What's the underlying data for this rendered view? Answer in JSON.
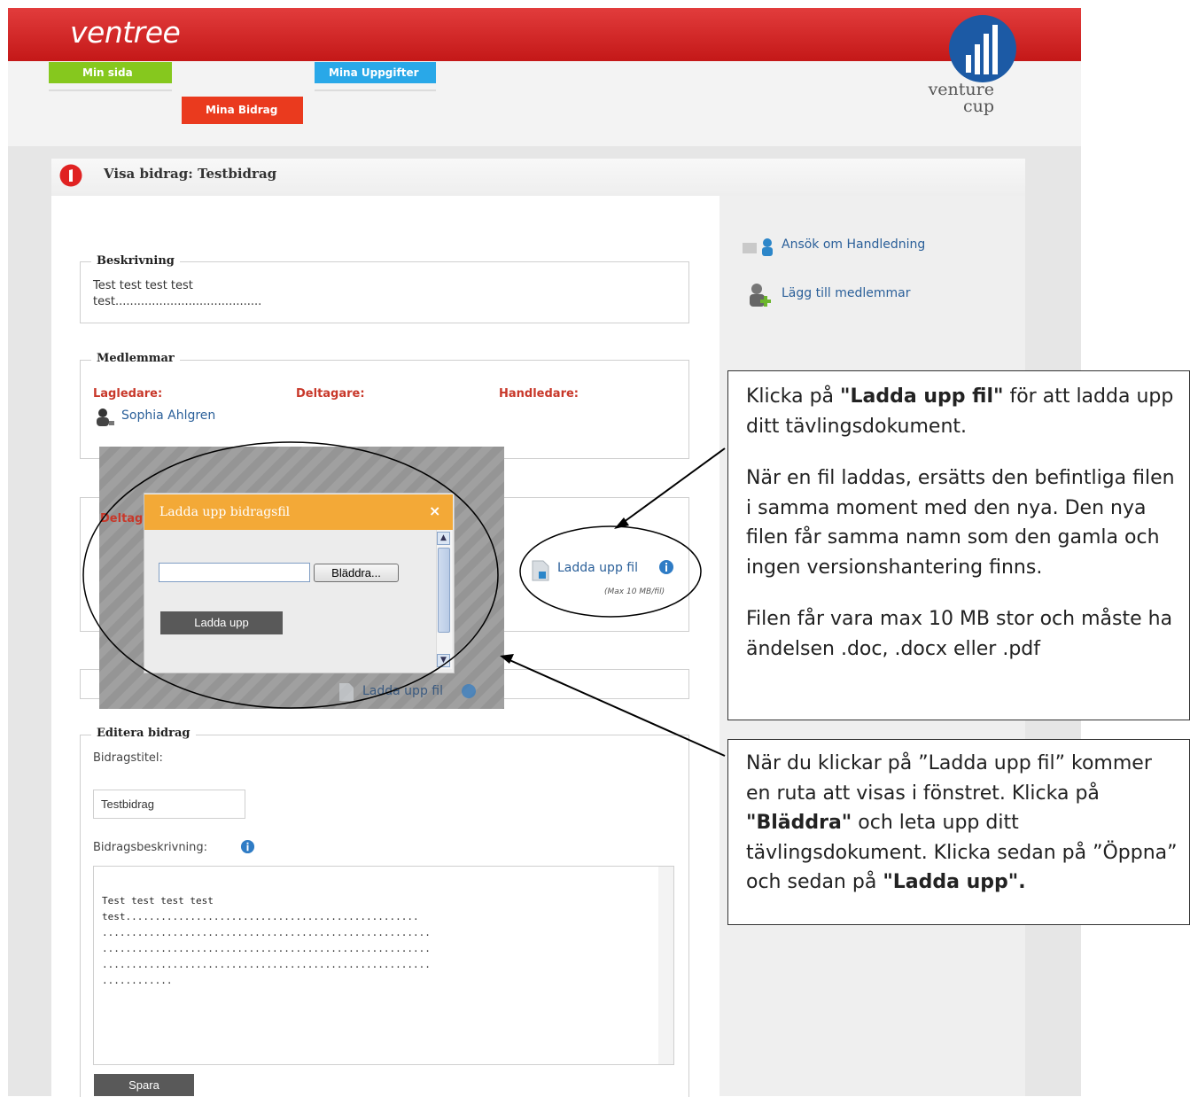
{
  "header": {
    "logo": "ventree",
    "brand": [
      "venture",
      "cup"
    ]
  },
  "nav": {
    "min_sida": "Min sida",
    "mina_uppgifter": "Mina Uppgifter",
    "mina_bidrag": "Mina Bidrag"
  },
  "page": {
    "step": "1",
    "title": "Visa bidrag: Testbidrag"
  },
  "sidebar": {
    "apply_mentor": "Ansök om Handledning",
    "add_members": "Lägg till medlemmar"
  },
  "beskrivning": {
    "legend": "Beskrivning",
    "line1": "Test test test test",
    "line2": "test........................................"
  },
  "medlemmar": {
    "legend": "Medlemmar",
    "lagledare": "Lagledare:",
    "deltagare": "Deltagare:",
    "handledare": "Handledare:",
    "member_name": "Sophia Ahlgren"
  },
  "upload": {
    "link": "Ladda upp fil",
    "max": "(Max 10 MB/fil)",
    "partial_label": "Deltag"
  },
  "dialog": {
    "title": "Ladda upp bidragsfil",
    "close": "×",
    "browse": "Bläddra...",
    "upload_button": "Ladda upp"
  },
  "editera": {
    "legend": "Editera bidrag",
    "title_label": "Bidragstitel:",
    "title_value": "Testbidrag",
    "desc_label": "Bidragsbeskrivning:",
    "desc_lines": [
      "Test test test test",
      "test..................................................",
      "........................................................",
      "........................................................",
      "........................................................",
      "............"
    ],
    "save": "Spara"
  },
  "callout1": {
    "p1_pre": "Klicka på ",
    "p1_bold": "\"Ladda upp fil\"",
    "p1_post": " för att ladda upp ditt tävlingsdokument.",
    "p2": "När en fil laddas, ersätts den befintliga filen i samma moment med den nya. Den nya filen får samma namn som den gamla och ingen versionshantering finns.",
    "p3": "Filen får vara max 10 MB stor och måste ha ändelsen .doc, .docx eller .pdf"
  },
  "callout2": {
    "t1": "När du klickar på ”Ladda upp fil” kommer en ruta att visas i fönstret. Klicka på ",
    "b1": "\"Bläddra\"",
    "t2": " och leta upp ditt tävlingsdokument. Klicka sedan på ”Öppna” och sedan på ",
    "b2": "\"Ladda upp\"."
  },
  "colors": {
    "red": "#d42020",
    "green": "#86c81e",
    "blue": "#29a8e8",
    "orange": "#f2a936",
    "link": "#2a5f99"
  }
}
